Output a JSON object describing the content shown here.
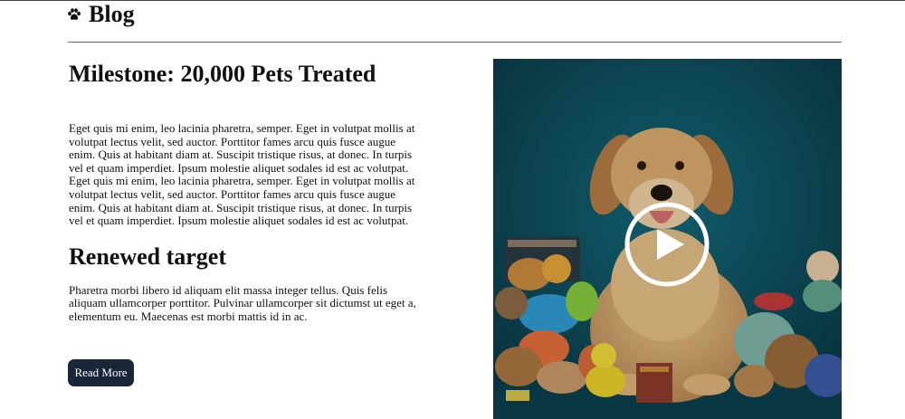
{
  "header": {
    "logo_icon": "paw-icon",
    "title": "Blog"
  },
  "article": {
    "title": "Milestone: 20,000 Pets Treated",
    "intro": "Eget quis mi enim, leo lacinia pharetra, semper. Eget in volutpat mollis at volutpat lectus velit, sed auctor. Porttitor fames arcu quis fusce augue enim. Quis at habitant diam at. Suscipit tristique risus, at donec. In turpis vel et quam imperdiet. Ipsum molestie aliquet sodales id est ac volutpat. Eget quis mi enim, leo lacinia pharetra, semper. Eget in volutpat mollis at volutpat lectus velit, sed auctor. Porttitor fames arcu quis fusce augue enim. Quis at habitant diam at. Suscipit tristique risus, at donec. In turpis vel et quam imperdiet. Ipsum molestie aliquet sodales id est ac volutpat.",
    "section_title": "Renewed target",
    "section_body": "Pharetra morbi libero id aliquam elit massa integer tellus. Quis felis aliquam ullamcorper porttitor. Pulvinar ullamcorper sit dictumst ut eget a, elementum eu. Maecenas est morbi mattis id in ac.",
    "read_more_label": "Read More"
  },
  "media": {
    "image_subject": "golden-retriever-with-toys",
    "play_icon": "play-icon"
  },
  "colors": {
    "button_bg": "#1d2538",
    "media_bg": "#0e4e5f"
  }
}
